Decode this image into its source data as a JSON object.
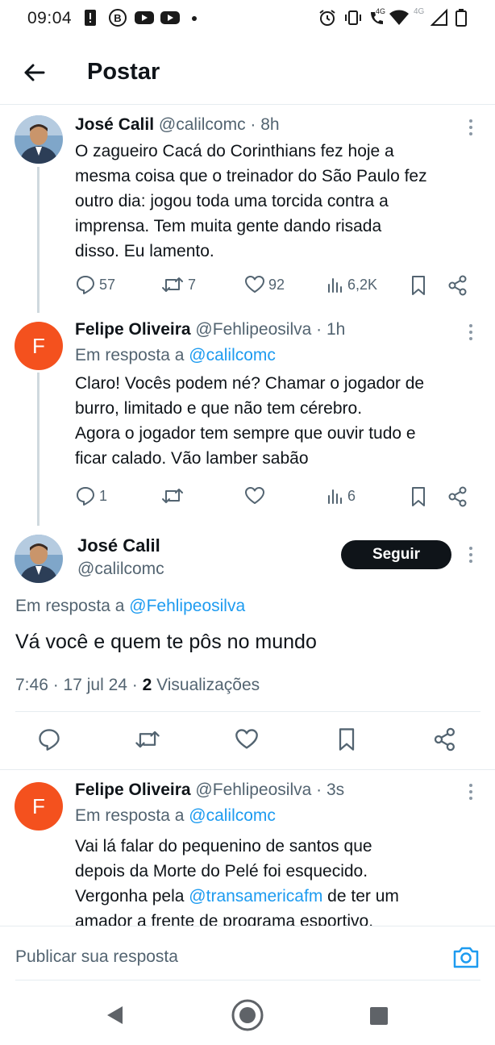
{
  "status_bar": {
    "time": "09:04",
    "signal_label_1": "4G",
    "signal_label_2": "4G"
  },
  "header": {
    "title": "Postar"
  },
  "tweets": [
    {
      "author": "José Calil",
      "handle_time": "@calilcomc · 8h",
      "text_lines": [
        "O zagueiro Cacá do Corinthians fez hoje a",
        "mesma coisa que o treinador do São Paulo fez",
        "outro dia: jogou toda uma torcida contra a",
        "imprensa. Tem muita gente dando risada",
        "disso. Eu lamento."
      ],
      "replies": "57",
      "retweets": "7",
      "likes": "92",
      "views": "6,2K"
    },
    {
      "author": "Felipe Oliveira",
      "handle_time": "@Fehlipeosilva · 1h",
      "avatar_letter": "F",
      "reply_prefix": "Em resposta a",
      "reply_to": "@calilcomc",
      "text_lines": [
        "Claro! Vocês podem né? Chamar o jogador de",
        "burro, limitado e que não tem cérebro.",
        "Agora o jogador tem sempre que ouvir tudo e",
        "ficar calado. Vão lamber sabão"
      ],
      "replies": "1",
      "views": "6"
    }
  ],
  "main_tweet": {
    "author": "José Calil",
    "handle": "@calilcomc",
    "follow_label": "Seguir",
    "reply_prefix": "Em resposta a",
    "reply_to": "@Fehlipeosilva",
    "text": "Vá você e quem te pôs no mundo",
    "timestamp": "7:46 · 17 jul 24 · ",
    "views_count": "2",
    "views_label": " Visualizações"
  },
  "reply_tweet": {
    "author": "Felipe Oliveira",
    "handle_time": "@Fehlipeosilva · 3s",
    "avatar_letter": "F",
    "reply_prefix": "Em resposta a",
    "reply_to": "@calilcomc",
    "line1": "Vai lá falar do pequenino de santos que",
    "line2": "depois da Morte do Pelé foi esquecido.",
    "line3_a": "Vergonha pela ",
    "line3_link": "@transamericafm",
    "line3_b": " de ter um",
    "line4": "amador a frente de programa esportivo."
  },
  "composer": {
    "placeholder": "Publicar sua resposta"
  },
  "colors": {
    "link": "#1d9bf0",
    "secondary_text": "#536471",
    "avatar_orange": "#f4511e"
  }
}
